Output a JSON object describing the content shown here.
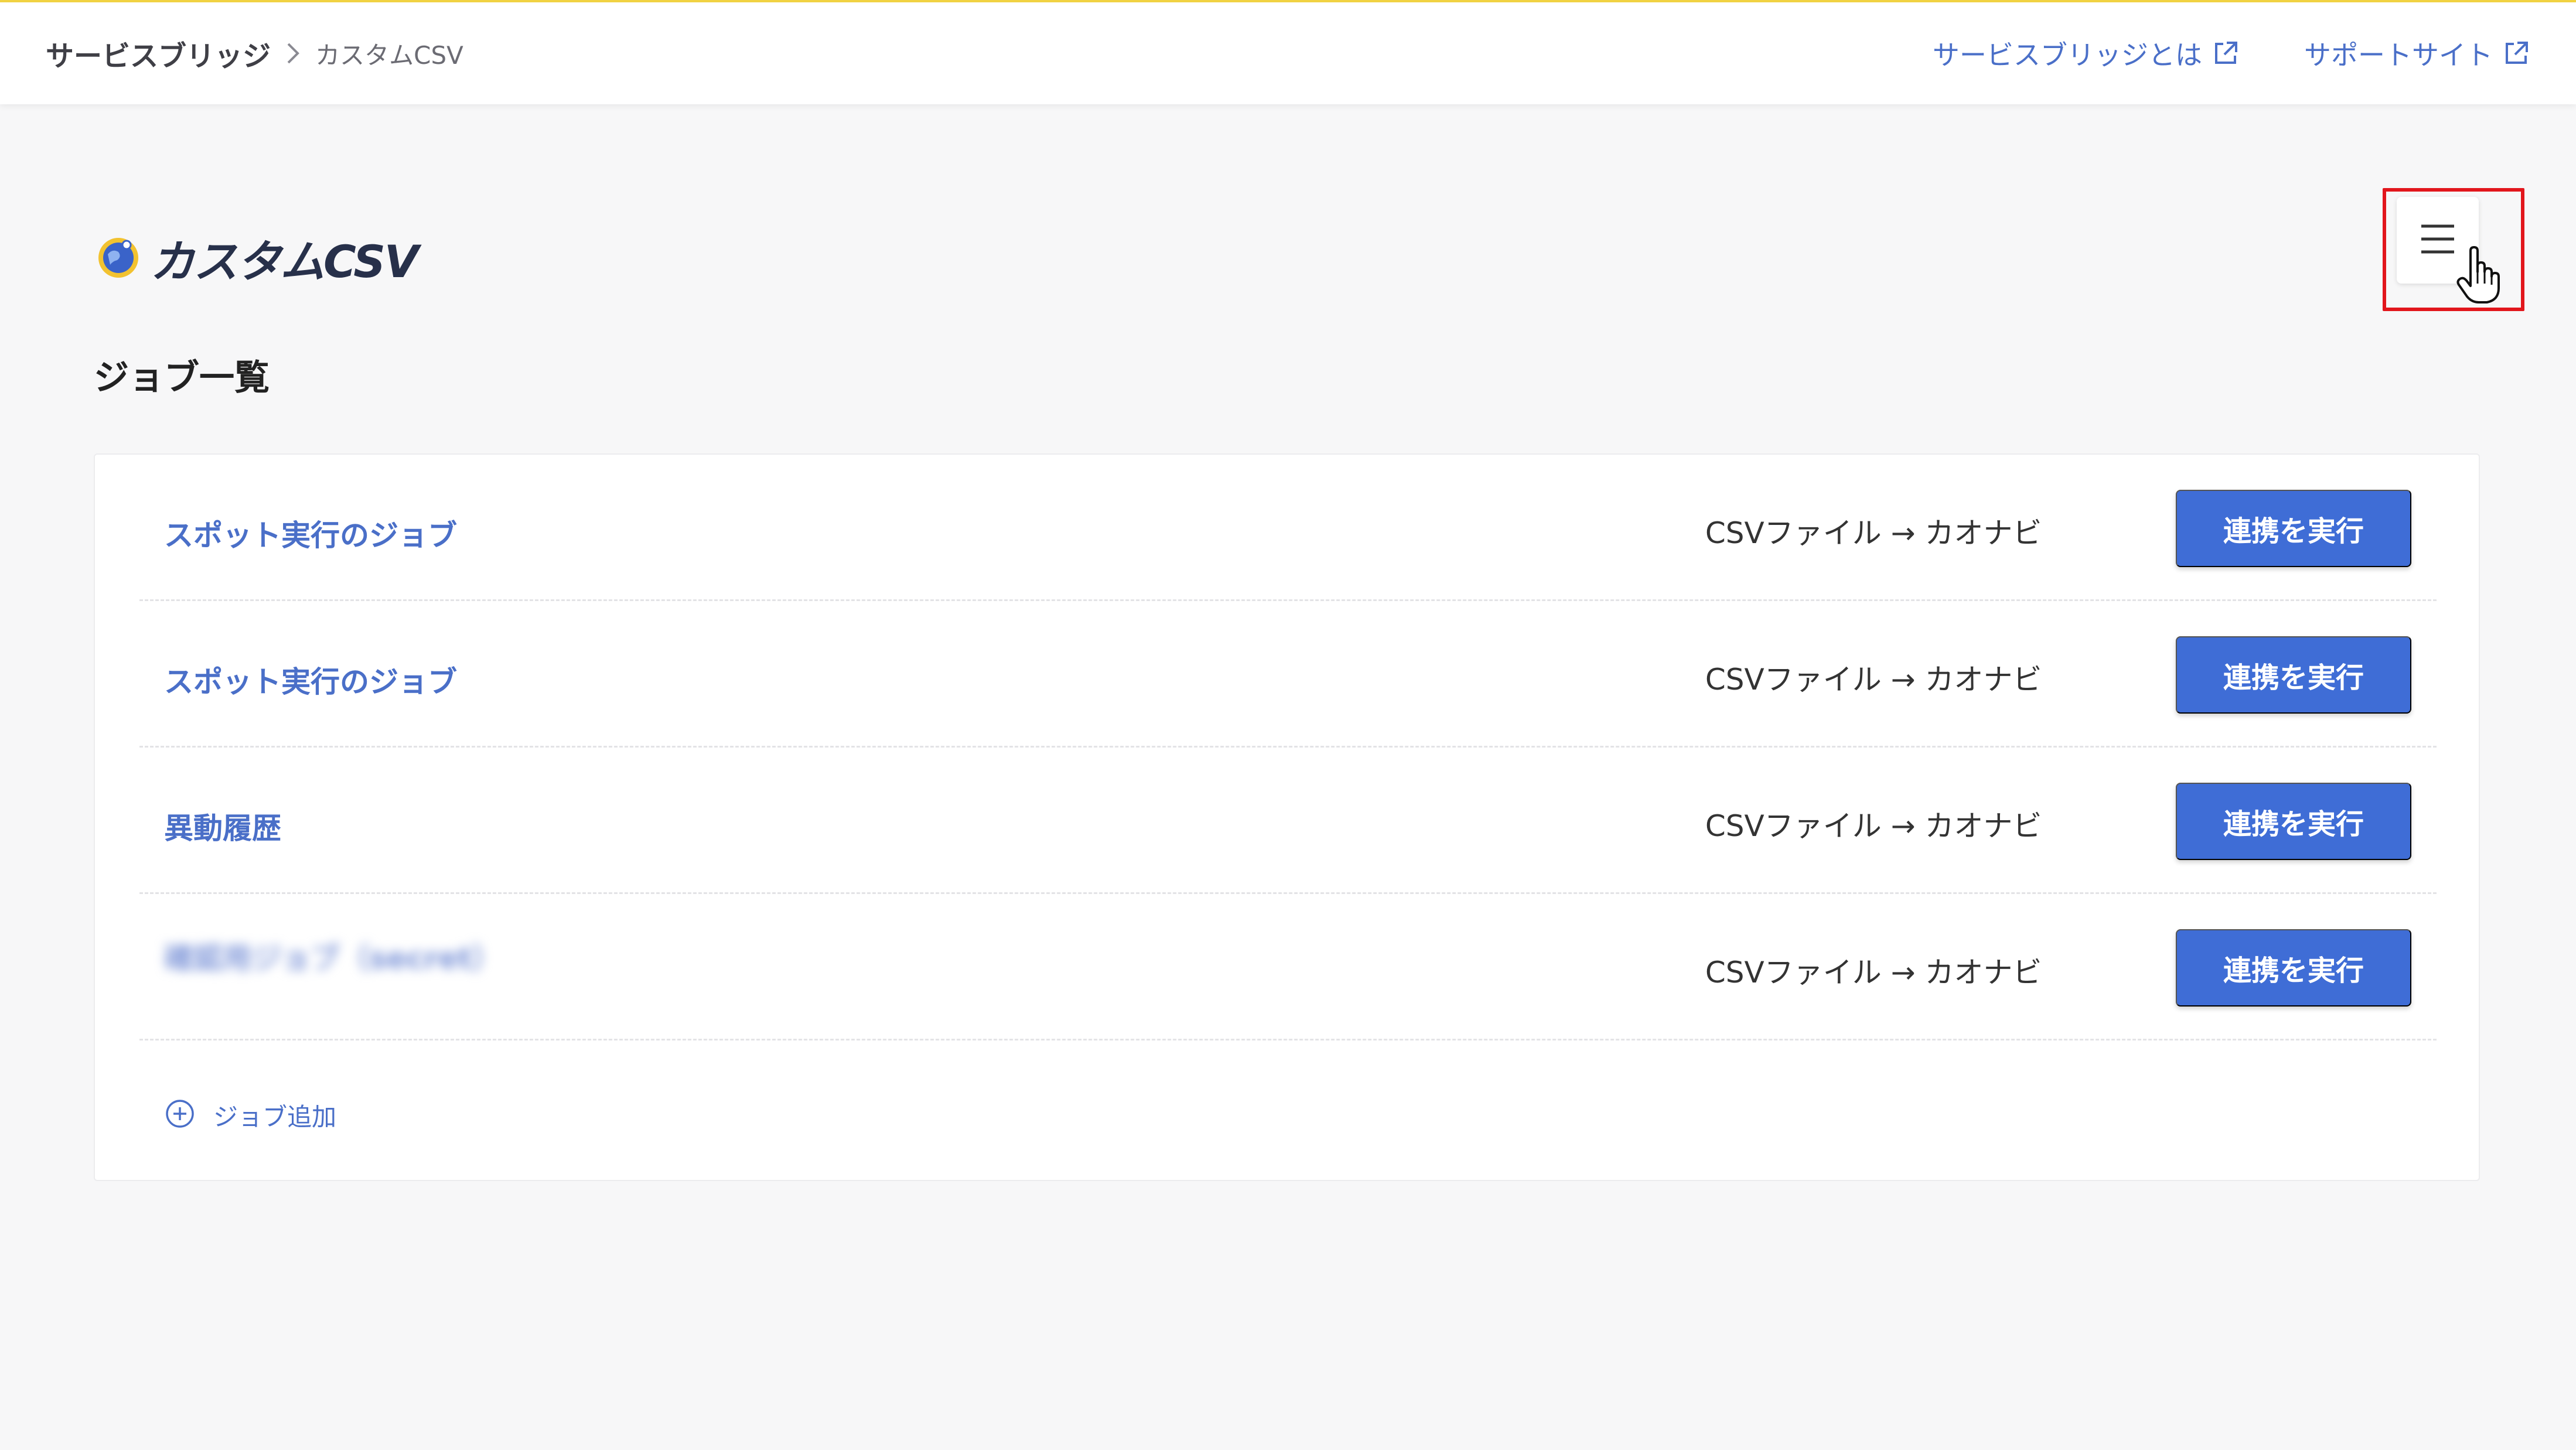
{
  "header": {
    "breadcrumb": {
      "root": "サービスブリッジ",
      "current": "カスタムCSV"
    },
    "links": [
      {
        "label": "サービスブリッジとは",
        "icon": "external-link-icon"
      },
      {
        "label": "サポートサイト",
        "icon": "external-link-icon"
      }
    ],
    "accent_color": "#f1d243"
  },
  "app": {
    "logo_text": "カスタムCSV",
    "logo_icon": "globe-logo-icon"
  },
  "menu": {
    "icon": "hamburger-menu-icon",
    "highlight_color": "#e2161c"
  },
  "main": {
    "section_title": "ジョブ一覧",
    "jobs": [
      {
        "name": "スポット実行のジョブ",
        "flow": "CSVファイル → カオナビ",
        "button_label": "連携を実行"
      },
      {
        "name": "スポット実行のジョブ",
        "flow": "CSVファイル → カオナビ",
        "button_label": "連携を実行"
      },
      {
        "name": "異動履歴",
        "flow": "CSVファイル → カオナビ",
        "button_label": "連携を実行"
      },
      {
        "name": "確認用ジョブ（secret）",
        "flow": "CSVファイル → カオナビ",
        "button_label": "連携を実行"
      }
    ],
    "add_job_label": "ジョブ追加",
    "button_color": "#3f6dd6",
    "link_color": "#4a6fc8"
  }
}
